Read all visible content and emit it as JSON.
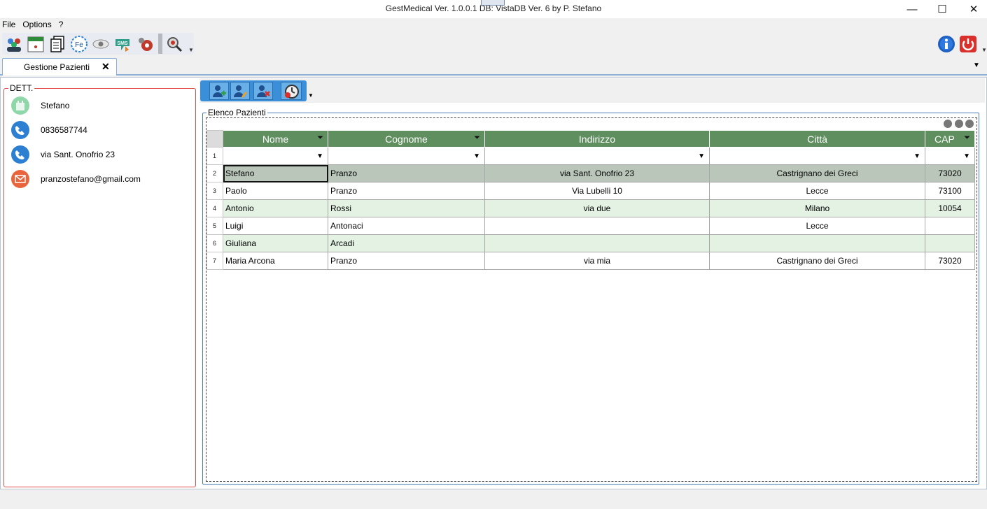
{
  "window": {
    "title": "GestMedical Ver. 1.0.0.1 DB: VistaDB Ver. 6 by P. Stefano",
    "minimize": "—",
    "maximize": "☐",
    "close": "✕"
  },
  "menu": [
    "File",
    "Options",
    "?"
  ],
  "toolbar": {
    "icons": [
      "patients-icon",
      "calendar-icon",
      "documents-icon",
      "fe-icon",
      "eye-icon",
      "sms-icon",
      "settings-icon",
      "search-tool-icon"
    ],
    "fe_label": "Fe",
    "sms_label": "SMS",
    "right_icons": [
      "info-icon",
      "power-icon"
    ]
  },
  "tab": {
    "label": "Gestione Pazienti",
    "close": "✕"
  },
  "details": {
    "legend": "DETT.",
    "name": "Stefano",
    "phone": "0836587744",
    "address": "via Sant. Onofrio 23",
    "email": "pranzostefano@gmail.com"
  },
  "grid": {
    "legend": "Elenco Pazienti",
    "columns": [
      "Nome",
      "Cognome",
      "Indirizzo",
      "Città",
      "CAP"
    ],
    "filter_row_number": "1",
    "rows": [
      {
        "n": "2",
        "nome": "Stefano",
        "cognome": "Pranzo",
        "indirizzo": "via Sant. Onofrio 23",
        "citta": "Castrignano dei Greci",
        "cap": "73020"
      },
      {
        "n": "3",
        "nome": "Paolo",
        "cognome": "Pranzo",
        "indirizzo": "Via Lubelli 10",
        "citta": "Lecce",
        "cap": "73100"
      },
      {
        "n": "4",
        "nome": "Antonio",
        "cognome": "Rossi",
        "indirizzo": "via due",
        "citta": "Milano",
        "cap": "10054"
      },
      {
        "n": "5",
        "nome": "Luigi",
        "cognome": "Antonaci",
        "indirizzo": "",
        "citta": "Lecce",
        "cap": ""
      },
      {
        "n": "6",
        "nome": "Giuliana",
        "cognome": "Arcadi",
        "indirizzo": "",
        "citta": "",
        "cap": ""
      },
      {
        "n": "7",
        "nome": "Maria Arcona",
        "cognome": "Pranzo",
        "indirizzo": "via mia",
        "citta": "Castrignano dei Greci",
        "cap": "73020"
      }
    ]
  },
  "colors": {
    "header_green": "#5f8f5f",
    "row_alt": "#e4f2e4",
    "row_selected": "#b9c6b9",
    "dett_border": "#e24a4a"
  }
}
